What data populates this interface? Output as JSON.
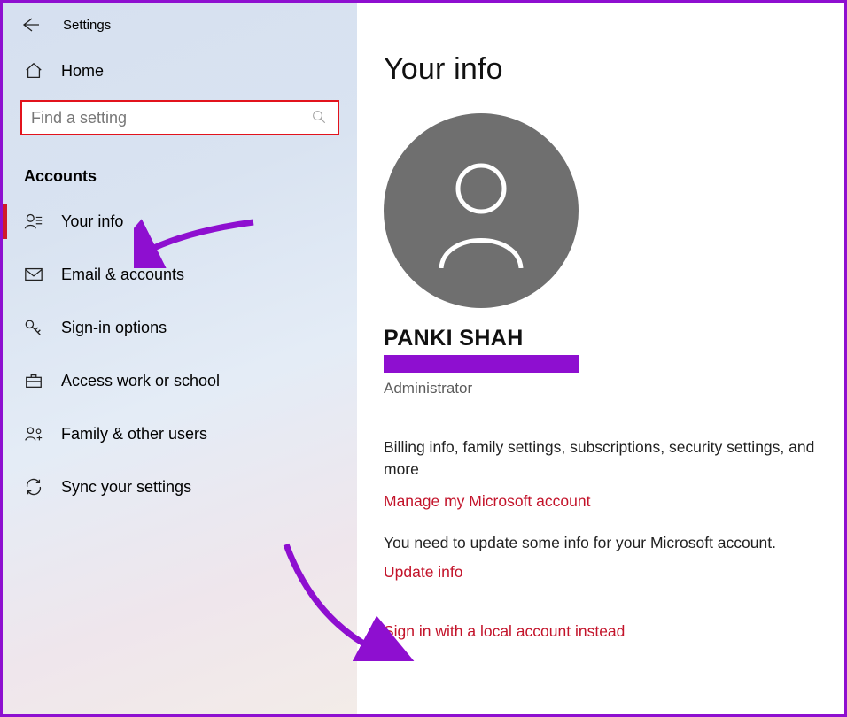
{
  "window": {
    "title": "Settings"
  },
  "sidebar": {
    "home_label": "Home",
    "search_placeholder": "Find a setting",
    "section": "Accounts",
    "items": [
      {
        "key": "your-info",
        "label": "Your info",
        "selected": true
      },
      {
        "key": "email-accounts",
        "label": "Email & accounts",
        "selected": false
      },
      {
        "key": "sign-in-options",
        "label": "Sign-in options",
        "selected": false
      },
      {
        "key": "access-work-school",
        "label": "Access work or school",
        "selected": false
      },
      {
        "key": "family-other-users",
        "label": "Family & other users",
        "selected": false
      },
      {
        "key": "sync-settings",
        "label": "Sync your settings",
        "selected": false
      }
    ]
  },
  "main": {
    "heading": "Your info",
    "user_name": "PANKI SHAH",
    "role": "Administrator",
    "billing_text": "Billing info, family settings, subscriptions, security settings, and more",
    "manage_link": "Manage my Microsoft account",
    "update_prompt": "You need to update some info for your Microsoft account.",
    "update_link": "Update info",
    "local_link": "Sign in with a local account instead"
  },
  "annotations": {
    "search_box_highlight_color": "#e2131c",
    "arrow_color": "#8e0fd0",
    "redaction_color": "#8e0fd0"
  }
}
